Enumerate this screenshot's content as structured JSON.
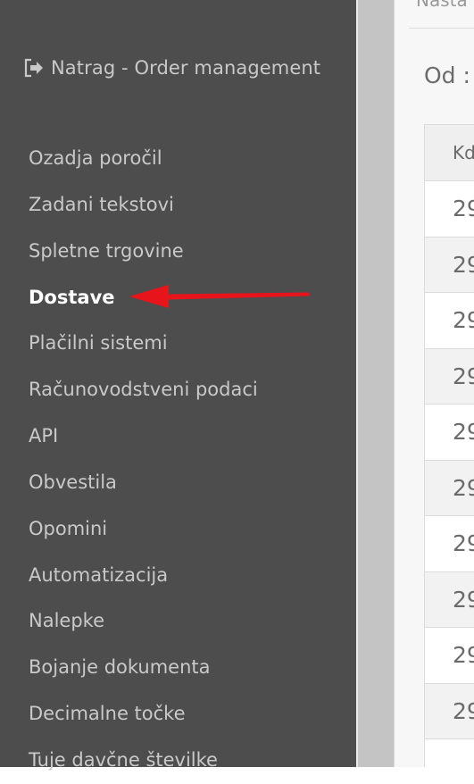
{
  "sidebar": {
    "back_link": {
      "label": "Natrag - Order management",
      "icon": "sign-out-icon"
    },
    "items": [
      {
        "label": "Ozadja poročil"
      },
      {
        "label": "Zadani tekstovi"
      },
      {
        "label": "Spletne trgovine"
      },
      {
        "label": "Dostave",
        "active": true
      },
      {
        "label": "Plačilni sistemi"
      },
      {
        "label": "Računovodstveni podaci"
      },
      {
        "label": "API"
      },
      {
        "label": "Obvestila"
      },
      {
        "label": "Opomini"
      },
      {
        "label": "Automatizacija"
      },
      {
        "label": "Nalepke"
      },
      {
        "label": "Bojanje dokumenta"
      },
      {
        "label": "Decimalne točke"
      },
      {
        "label": "Tuje davčne številke"
      }
    ]
  },
  "annotation": {
    "type": "red-arrow",
    "target": "Dostave",
    "color": "#e8141c"
  },
  "main": {
    "top_text": "Nasta",
    "od_label": "Od :",
    "table": {
      "header": "Kd",
      "rows": [
        "29",
        "29",
        "29",
        "29",
        "29",
        "29",
        "29",
        "29",
        "29",
        "29",
        ""
      ]
    }
  },
  "colors": {
    "sidebar_bg": "#4d4d4d",
    "sidebar_text": "#c9c9c9",
    "active_text": "#ffffff",
    "arrow": "#e8141c"
  }
}
